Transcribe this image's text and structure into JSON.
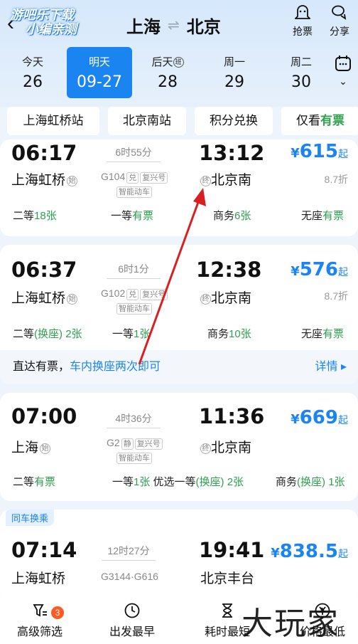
{
  "header": {
    "back_icon": "chevron-left-icon",
    "watermark_line1": "游吧乐下载",
    "watermark_line2": "小编亲测",
    "from": "上海",
    "swap_symbol": "⇌",
    "to": "北京",
    "grab_label": "抢票",
    "share_label": "分享"
  },
  "dates": [
    {
      "weekday": "今天",
      "day": "26"
    },
    {
      "weekday": "明天",
      "day": "09-27"
    },
    {
      "weekday": "后天",
      "day": "28",
      "tag": "班"
    },
    {
      "weekday": "周一",
      "day": "29"
    },
    {
      "weekday": "周二",
      "day": "30"
    }
  ],
  "filters": {
    "chip1": "上海虹桥站",
    "chip2": "北京南站",
    "chip3": "积分兑换",
    "chip4_prefix": "仅看",
    "chip4_em": "有票"
  },
  "trains": [
    {
      "dep_time": "06:17",
      "dep_station": "上海虹桥",
      "dep_tag": "始",
      "duration": "6时55分",
      "train_no": "G104",
      "badges": [
        "兑",
        "复兴号"
      ],
      "badge2": "智能动车",
      "arr_time": "13:12",
      "arr_station": "北京南",
      "arr_tag": "终",
      "price": "615",
      "price_suffix": "起",
      "discount": "8.7折",
      "seats": [
        {
          "label": "二等",
          "value": "18张"
        },
        {
          "label": "一等",
          "value": "有票"
        },
        {
          "label": "商务",
          "value": "6张"
        },
        {
          "label": "无座",
          "value": "有票"
        }
      ]
    },
    {
      "dep_time": "06:37",
      "dep_station": "上海虹桥",
      "dep_tag": "始",
      "duration": "6时1分",
      "train_no": "G102",
      "badges": [
        "兑",
        "复兴号"
      ],
      "badge2": "智能动车",
      "arr_time": "12:38",
      "arr_station": "北京南",
      "arr_tag": "终",
      "price": "576",
      "price_suffix": "起",
      "discount": "8.7折",
      "seats": [
        {
          "label": "二等",
          "extra": "(换座)",
          "value": "2张"
        },
        {
          "label": "一等",
          "value": "1张"
        },
        {
          "label": "商务",
          "value": "10张"
        },
        {
          "label": "无座",
          "value": "有票"
        }
      ],
      "tip_text": "直达有票，",
      "tip_link": "车内换座两次即可",
      "tip_detail": "详情 ▸"
    },
    {
      "dep_time": "07:00",
      "dep_station": "上海",
      "dep_tag": "始",
      "duration": "4时36分",
      "train_no": "G2",
      "badges": [
        "静",
        "复兴号"
      ],
      "badge2": "智能动车",
      "arr_time": "11:36",
      "arr_station": "北京南",
      "arr_tag": "终",
      "price": "669",
      "price_suffix": "起",
      "seats": [
        {
          "label": "二等",
          "value": "有票"
        },
        {
          "label": "一等",
          "value": "1张"
        },
        {
          "label": "优选一等",
          "extra": "(换座)",
          "value": "2张"
        },
        {
          "label": "商务",
          "extra": "(换座)",
          "value": "1张"
        }
      ]
    },
    {
      "same_train_tag": "同车换乘",
      "dep_time": "07:14",
      "dep_station": "上海虹桥",
      "duration": "12时27分",
      "train_no": "G3144·G616",
      "arr_time": "19:41",
      "arr_station": "北京丰台",
      "price": "838.5",
      "price_suffix": "起"
    }
  ],
  "currency": "¥",
  "bottom_bar": {
    "filter_label": "高级筛选",
    "filter_badge": "3",
    "earliest_label": "出发最早",
    "shortest_label": "耗时最短",
    "cheapest_label": "价格最低"
  },
  "site_watermark": "大玩家",
  "annotation_color": "#d92020"
}
